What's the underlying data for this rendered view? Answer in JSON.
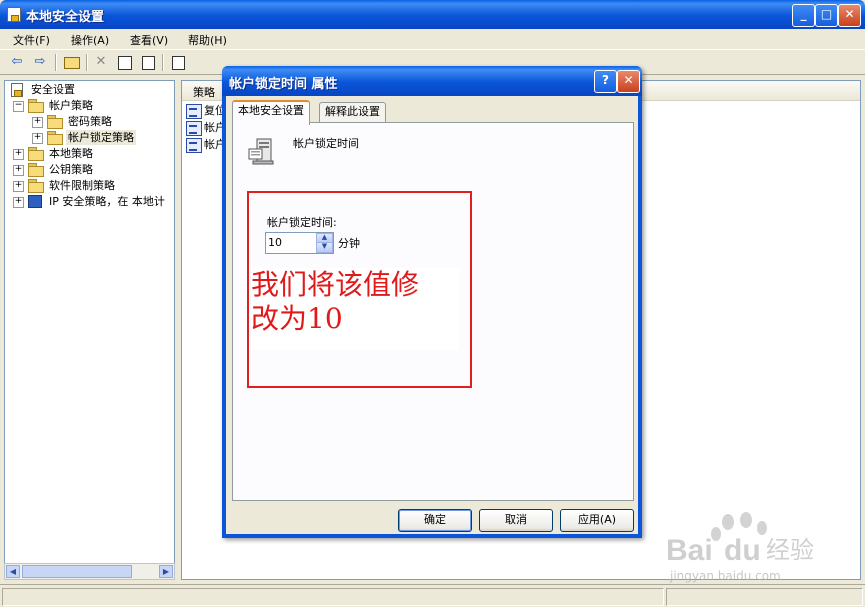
{
  "window": {
    "title": "本地安全设置"
  },
  "menu": [
    "文件(F)",
    "操作(A)",
    "查看(V)",
    "帮助(H)"
  ],
  "tree": {
    "root": "安全设置",
    "items": [
      {
        "label": "帐户策略"
      },
      {
        "label": "密码策略"
      },
      {
        "label": "帐户锁定策略"
      },
      {
        "label": "本地策略"
      },
      {
        "label": "公钥策略"
      },
      {
        "label": "软件限制策略"
      },
      {
        "label": "IP 安全策略，在 本地计"
      }
    ]
  },
  "list": {
    "column_header": "策略",
    "rows": [
      "复位",
      "帐户",
      "帐户"
    ]
  },
  "dialog": {
    "title": "帐户锁定时间 属性",
    "help_label": "?",
    "close_label": "✕",
    "tabs": [
      "本地安全设置",
      "解释此设置"
    ],
    "heading": "帐户锁定时间",
    "field_label": "帐户锁定时间:",
    "field_value": "10",
    "unit": "分钟",
    "annotation_line1": "我们将该值修",
    "annotation_line2": "改为10",
    "buttons": {
      "ok": "确定",
      "cancel": "取消",
      "apply": "应用(A)"
    }
  },
  "watermark": {
    "brand": "Baidu经验",
    "url": "jingyan.baidu.com"
  }
}
